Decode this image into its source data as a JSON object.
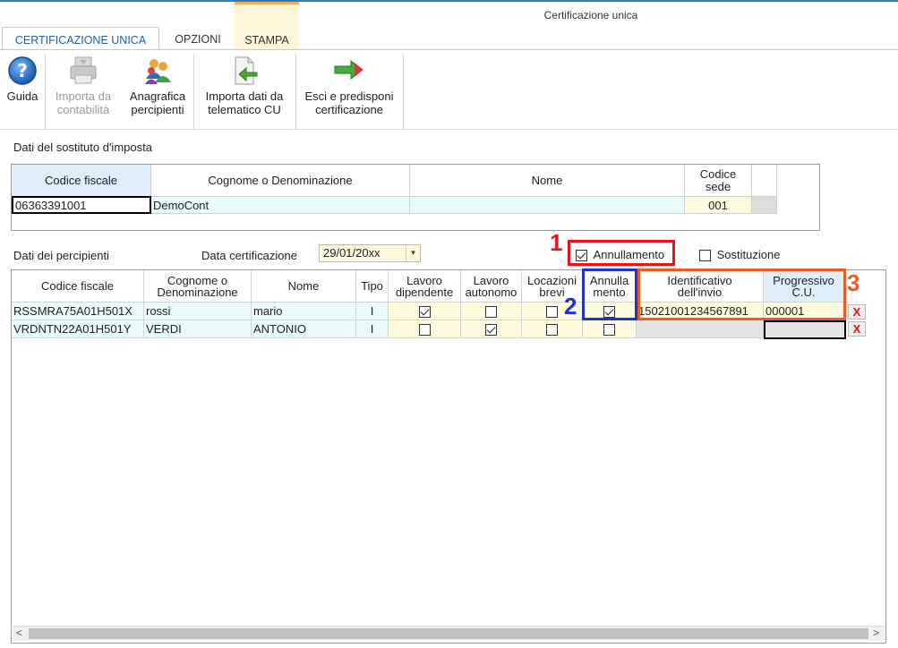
{
  "window": {
    "title": "Certificazione unica"
  },
  "tabs": [
    {
      "label": "CERTIFICAZIONE UNICA"
    },
    {
      "label": "OPZIONI"
    },
    {
      "label": "STAMPA"
    }
  ],
  "ribbon": {
    "guida": {
      "label": "Guida",
      "icon": "help-icon"
    },
    "importa_contabilita": {
      "line1": "Importa da",
      "line2": "contabilità",
      "icon": "import-printer-icon"
    },
    "anagrafica": {
      "line1": "Anagrafica",
      "line2": "percipienti",
      "icon": "people-icon"
    },
    "importa_telematico": {
      "line1": "Importa dati da",
      "line2": "telematico CU",
      "icon": "import-document-icon"
    },
    "esci": {
      "line1": "Esci e predisponi",
      "line2": "certificazione",
      "icon": "exit-arrow-icon"
    }
  },
  "sostituto": {
    "section_label": "Dati del sostituto d'imposta",
    "headers": {
      "codice_fiscale": "Codice fiscale",
      "cognome": "Cognome o Denominazione",
      "nome": "Nome",
      "codice_sede_1": "Codice",
      "codice_sede_2": "sede"
    },
    "values": {
      "codice_fiscale": "06363391001",
      "cognome": "DemoCont",
      "nome": "",
      "codice_sede": "001"
    }
  },
  "percipienti": {
    "section_label": "Dati dei percipienti",
    "data_certificazione_label": "Data certificazione",
    "data_certificazione_value": "29/01/20xx",
    "annullamento_label": "Annullamento",
    "annullamento_checked": true,
    "sostituzione_label": "Sostituzione",
    "sostituzione_checked": false,
    "headers": {
      "codice_fiscale": "Codice fiscale",
      "cognome_1": "Cognome o",
      "cognome_2": "Denominazione",
      "nome": "Nome",
      "tipo": "Tipo",
      "lav_dip_1": "Lavoro",
      "lav_dip_2": "dipendente",
      "lav_aut_1": "Lavoro",
      "lav_aut_2": "autonomo",
      "loc_1": "Locazioni",
      "loc_2": "brevi",
      "ann_1": "Annulla",
      "ann_2": "mento",
      "id_1": "Identificativo",
      "id_2": "dell'invio",
      "prog_1": "Progressivo",
      "prog_2": "C.U."
    },
    "rows": [
      {
        "codice_fiscale": "RSSMRA75A01H501X",
        "cognome": "rossi",
        "nome": "mario",
        "tipo": "I",
        "lavoro_dipendente": true,
        "lavoro_autonomo": false,
        "locazioni_brevi": false,
        "annullamento": true,
        "identificativo_invio": "15021001234567891",
        "progressivo": "000001",
        "delete_label": "X"
      },
      {
        "codice_fiscale": "VRDNTN22A01H501Y",
        "cognome": "VERDI",
        "nome": "ANTONIO",
        "tipo": "I",
        "lavoro_dipendente": false,
        "lavoro_autonomo": true,
        "locazioni_brevi": false,
        "annullamento": false,
        "identificativo_invio": "",
        "progressivo": "",
        "delete_label": "X"
      }
    ]
  },
  "annotations": [
    {
      "number": "1",
      "color": "#e8141b"
    },
    {
      "number": "2",
      "color": "#1e34c9"
    },
    {
      "number": "3",
      "color": "#ee5a24"
    }
  ],
  "scrollbar": {
    "left_arrow": "<",
    "right_arrow": ">"
  }
}
